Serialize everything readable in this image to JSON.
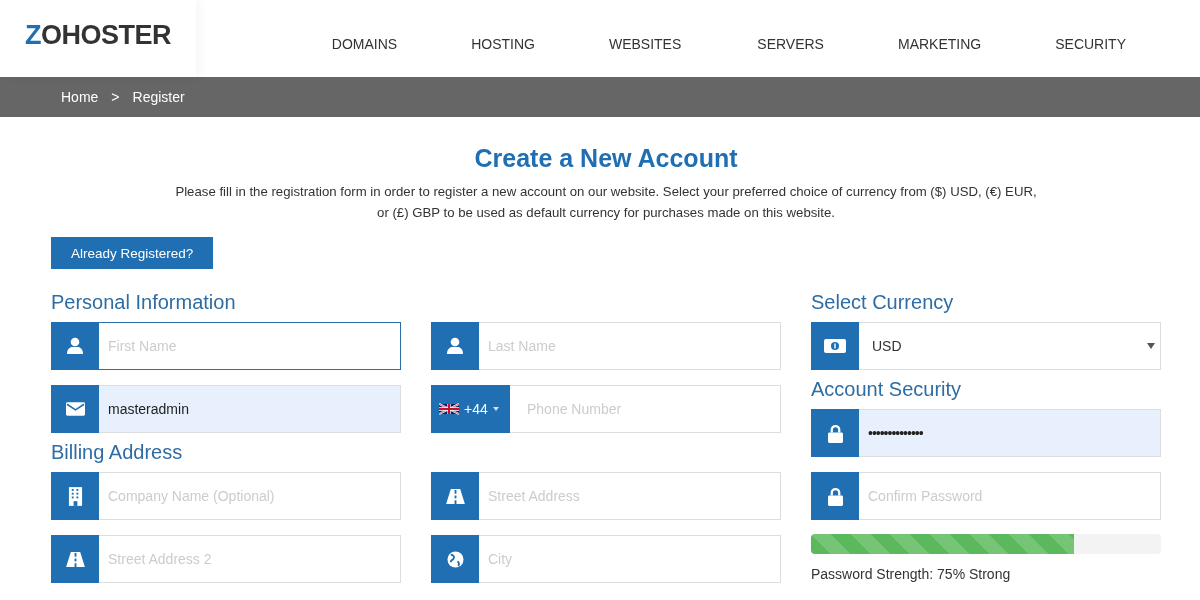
{
  "header": {
    "logo": "ZOHOSTER",
    "nav": [
      "DOMAINS",
      "HOSTING",
      "WEBSITES",
      "SERVERS",
      "MARKETING",
      "SECURITY"
    ]
  },
  "breadcrumb": {
    "items": [
      "Home",
      "Register"
    ],
    "separator": ">"
  },
  "title": "Create a New Account",
  "intro": "Please fill in the registration form in order to register a new account on our website. Select your preferred choice of currency from ($) USD, (€) EUR, or (£) GBP to be used as default currency for purchases made on this website.",
  "already_registered_button": "Already Registered?",
  "personal": {
    "heading": "Personal Information",
    "fields": [
      {
        "kind": "person",
        "placeholder": "First Name",
        "focused": true,
        "autofilled": false
      },
      {
        "kind": "person",
        "placeholder": "Last Name",
        "focused": false,
        "autofilled": false
      },
      {
        "kind": "email",
        "value": "masteradmin",
        "focused": false,
        "autofilled": true
      },
      {
        "kind": "phone",
        "dial_code": "+44",
        "placeholder": "Phone Number",
        "focused": false,
        "autofilled": false
      }
    ]
  },
  "billing": {
    "heading": "Billing Address",
    "fields": [
      {
        "kind": "building",
        "placeholder": "Company Name (Optional)",
        "focused": false,
        "autofilled": false
      },
      {
        "kind": "road",
        "placeholder": "Street Address",
        "focused": false,
        "autofilled": false
      },
      {
        "kind": "road",
        "placeholder": "Street Address 2",
        "focused": false,
        "autofilled": false
      },
      {
        "kind": "globe",
        "placeholder": "City",
        "focused": false,
        "autofilled": false
      }
    ]
  },
  "currency": {
    "heading": "Select Currency",
    "value": "USD"
  },
  "security": {
    "heading": "Account Security",
    "fields": [
      {
        "kind": "lock",
        "value": "••••••••••••••",
        "focused": false,
        "autofilled": true
      },
      {
        "kind": "lock",
        "placeholder": "Confirm Password",
        "focused": false,
        "autofilled": false
      }
    ],
    "strength": {
      "level": 0.75,
      "label": "Password Strength: 75% Strong"
    }
  }
}
